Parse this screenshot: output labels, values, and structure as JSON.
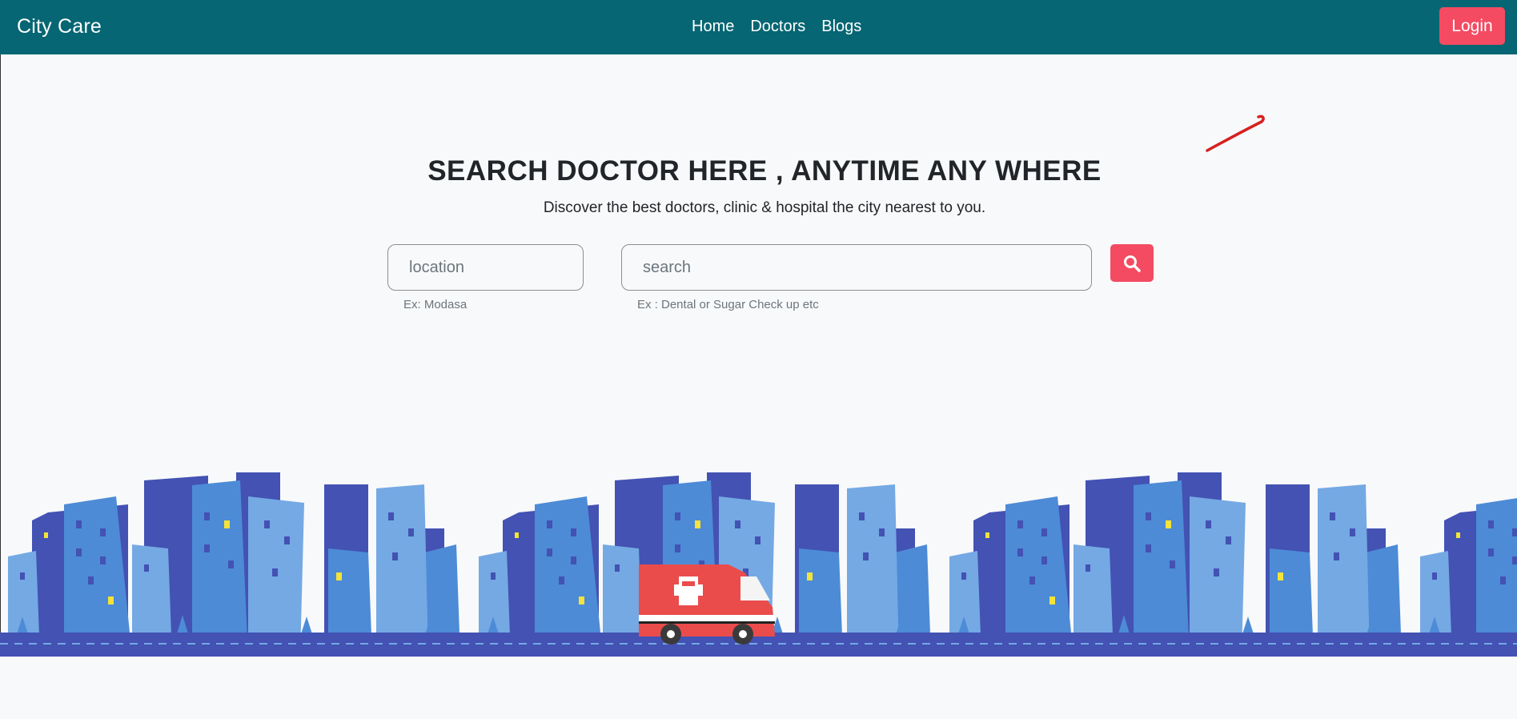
{
  "navbar": {
    "brand": "City Care",
    "links": [
      {
        "label": "Home"
      },
      {
        "label": "Doctors"
      },
      {
        "label": "Blogs"
      }
    ],
    "login_label": "Login"
  },
  "hero": {
    "title": "SEARCH DOCTOR HERE , ANYTIME ANY WHERE",
    "subtitle": "Discover the best doctors, clinic & hospital the city nearest to you."
  },
  "search": {
    "location_placeholder": "location",
    "location_hint": "Ex: Modasa",
    "query_placeholder": "search",
    "query_hint": "Ex : Dental or Sugar Check up etc",
    "button_icon": "search-icon"
  },
  "colors": {
    "navbar": "#066673",
    "accent": "#f44b62",
    "background": "#f8f9fa",
    "building_dark": "#4352b3",
    "building_mid": "#4d8bd6",
    "building_light": "#74a9e4",
    "window_lit": "#f3e33a"
  }
}
